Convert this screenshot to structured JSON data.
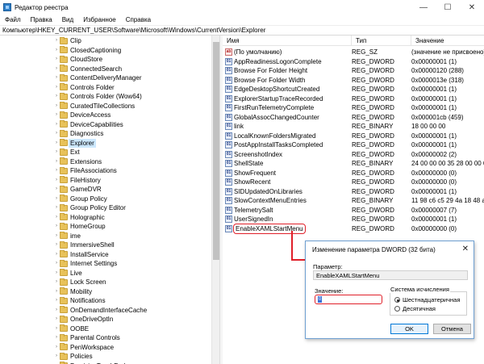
{
  "window": {
    "title": "Редактор реестра",
    "minimize": "—",
    "maximize": "☐",
    "close": "✕"
  },
  "menu": [
    "Файл",
    "Правка",
    "Вид",
    "Избранное",
    "Справка"
  ],
  "address": "Компьютер\\HKEY_CURRENT_USER\\Software\\Microsoft\\Windows\\CurrentVersion\\Explorer",
  "tree": {
    "items": [
      "Clip",
      "ClosedCaptioning",
      "CloudStore",
      "ConnectedSearch",
      "ContentDeliveryManager",
      "Controls Folder",
      "Controls Folder (Wow64)",
      "CuratedTileCollections",
      "DeviceAccess",
      "DeviceCapabilities",
      "Diagnostics",
      "Explorer",
      "Ext",
      "Extensions",
      "FileAssociations",
      "FileHistory",
      "GameDVR",
      "Group Policy",
      "Group Policy Editor",
      "Holographic",
      "HomeGroup",
      "ime",
      "ImmersiveShell",
      "InstallService",
      "Internet Settings",
      "Live",
      "Lock Screen",
      "Mobility",
      "Notifications",
      "OnDemandInterfaceCache",
      "OneDriveOptIn",
      "OOBE",
      "Parental Controls",
      "PenWorkspace",
      "Policies",
      "PrecisionTouchPad"
    ],
    "selected": "Explorer",
    "expander": "›"
  },
  "list": {
    "headers": {
      "name": "Имя",
      "type": "Тип",
      "value": "Значение"
    },
    "rows": [
      {
        "icon": "ab",
        "name": "(По умолчанию)",
        "type": "REG_SZ",
        "value": "(значение не присвоено)"
      },
      {
        "icon": "01",
        "name": "AppReadinessLogonComplete",
        "type": "REG_DWORD",
        "value": "0x00000001 (1)"
      },
      {
        "icon": "01",
        "name": "Browse For Folder Height",
        "type": "REG_DWORD",
        "value": "0x00000120 (288)"
      },
      {
        "icon": "01",
        "name": "Browse For Folder Width",
        "type": "REG_DWORD",
        "value": "0x0000013e (318)"
      },
      {
        "icon": "01",
        "name": "EdgeDesktopShortcutCreated",
        "type": "REG_DWORD",
        "value": "0x00000001 (1)"
      },
      {
        "icon": "01",
        "name": "ExplorerStartupTraceRecorded",
        "type": "REG_DWORD",
        "value": "0x00000001 (1)"
      },
      {
        "icon": "01",
        "name": "FirstRunTelemetryComplete",
        "type": "REG_DWORD",
        "value": "0x00000001 (1)"
      },
      {
        "icon": "01",
        "name": "GlobalAssocChangedCounter",
        "type": "REG_DWORD",
        "value": "0x000001cb (459)"
      },
      {
        "icon": "01",
        "name": "link",
        "type": "REG_BINARY",
        "value": "18 00 00 00"
      },
      {
        "icon": "01",
        "name": "LocalKnownFoldersMigrated",
        "type": "REG_DWORD",
        "value": "0x00000001 (1)"
      },
      {
        "icon": "01",
        "name": "PostAppInstallTasksCompleted",
        "type": "REG_DWORD",
        "value": "0x00000001 (1)"
      },
      {
        "icon": "01",
        "name": "ScreenshotIndex",
        "type": "REG_DWORD",
        "value": "0x00000002 (2)"
      },
      {
        "icon": "01",
        "name": "ShellState",
        "type": "REG_BINARY",
        "value": "24 00 00 00 35 28 00 00 00 0"
      },
      {
        "icon": "01",
        "name": "ShowFrequent",
        "type": "REG_DWORD",
        "value": "0x00000000 (0)"
      },
      {
        "icon": "01",
        "name": "ShowRecent",
        "type": "REG_DWORD",
        "value": "0x00000000 (0)"
      },
      {
        "icon": "01",
        "name": "SIDUpdatedOnLibraries",
        "type": "REG_DWORD",
        "value": "0x00000001 (1)"
      },
      {
        "icon": "01",
        "name": "SlowContextMenuEntries",
        "type": "REG_BINARY",
        "value": "11 98 c6 c5 29 4a 18 48 a4 b"
      },
      {
        "icon": "01",
        "name": "TelemetrySalt",
        "type": "REG_DWORD",
        "value": "0x00000007 (7)"
      },
      {
        "icon": "01",
        "name": "UserSignedIn",
        "type": "REG_DWORD",
        "value": "0x00000001 (1)"
      },
      {
        "icon": "01",
        "name": "EnableXAMLStartMenu",
        "type": "REG_DWORD",
        "value": "0x00000000 (0)"
      }
    ]
  },
  "dialog": {
    "title": "Изменение параметра DWORD (32 бита)",
    "close": "✕",
    "param_label": "Параметр:",
    "param_value": "EnableXAMLStartMenu",
    "value_label": "Значение:",
    "value": "0",
    "base_group": "Система исчисления",
    "hex": "Шестнадцатеричная",
    "dec": "Десятичная",
    "ok": "OK",
    "cancel": "Отмена"
  },
  "colors": {
    "annotation": "#e0202a",
    "selection": "#cce8ff",
    "accent": "#0078d7"
  }
}
